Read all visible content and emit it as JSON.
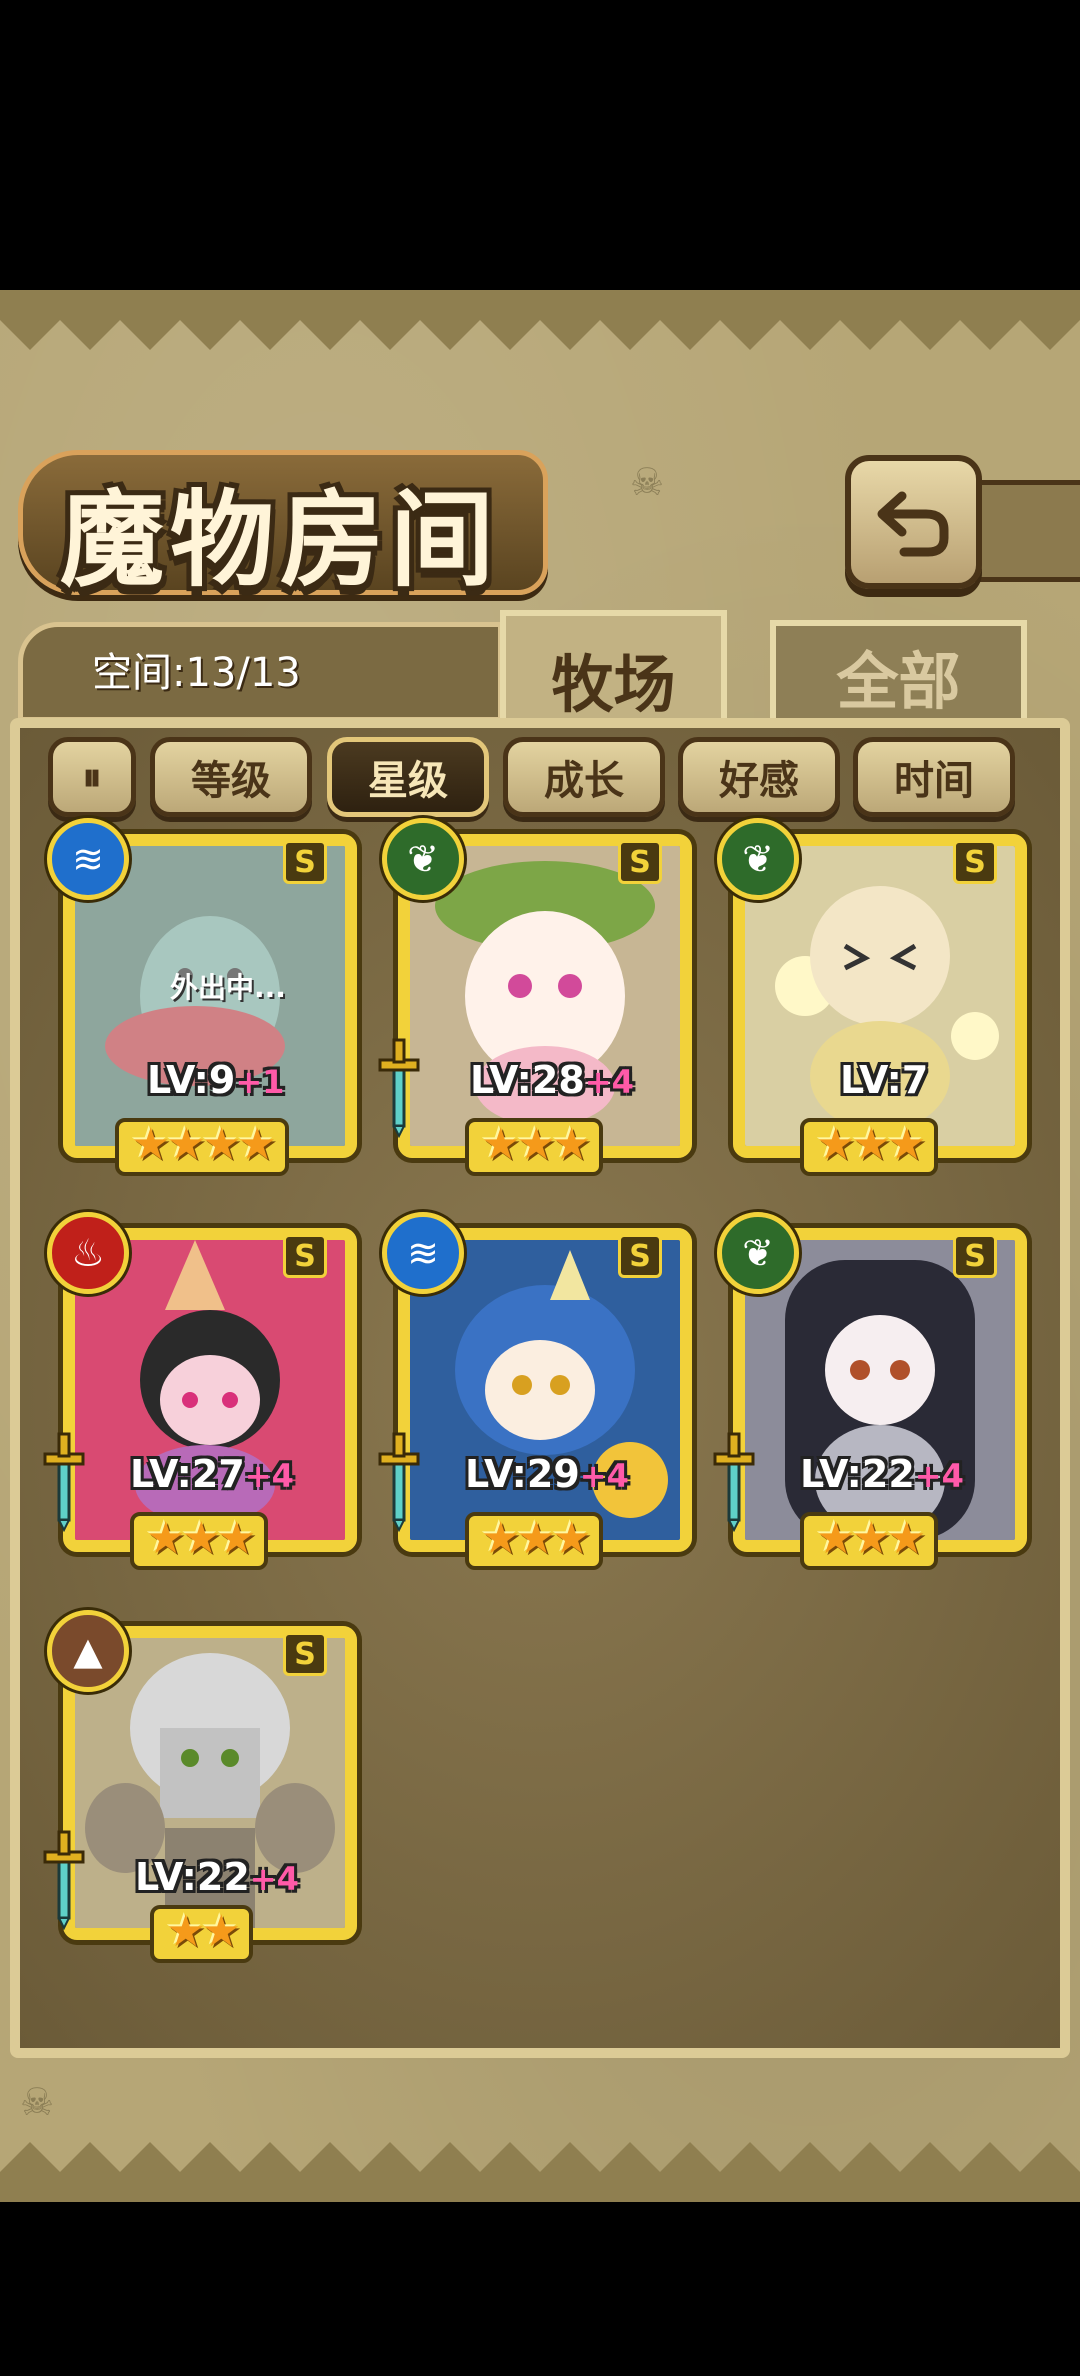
{
  "header": {
    "title": "魔物房间",
    "back_button": "return-icon"
  },
  "space": {
    "label": "空间:13/13"
  },
  "tabs": [
    {
      "label": "牧场",
      "active": true
    },
    {
      "label": "全部",
      "active": false
    }
  ],
  "filters": {
    "sort_icon": "sort-toggle-icon",
    "items": [
      {
        "label": "等级",
        "active": false
      },
      {
        "label": "星级",
        "active": true
      },
      {
        "label": "成长",
        "active": false
      },
      {
        "label": "好感",
        "active": false
      },
      {
        "label": "时间",
        "active": false
      }
    ]
  },
  "monsters": [
    {
      "grade": "S",
      "element": "water",
      "level": "LV:9",
      "bonus": "+1",
      "stars": "★★★★",
      "status": "外出中...",
      "weapon": false
    },
    {
      "grade": "S",
      "element": "wood",
      "level": "LV:28",
      "bonus": "+4",
      "stars": "★★★",
      "weapon": true
    },
    {
      "grade": "S",
      "element": "wood",
      "level": "LV:7",
      "bonus": "",
      "stars": "★★★",
      "weapon": false
    },
    {
      "grade": "S",
      "element": "fire",
      "level": "LV:27",
      "bonus": "+4",
      "stars": "★★★",
      "weapon": true
    },
    {
      "grade": "S",
      "element": "water",
      "level": "LV:29",
      "bonus": "+4",
      "stars": "★★★",
      "weapon": true
    },
    {
      "grade": "S",
      "element": "wood",
      "level": "LV:22",
      "bonus": "+4",
      "stars": "★★★",
      "weapon": true
    },
    {
      "grade": "S",
      "element": "earth",
      "level": "LV:22",
      "bonus": "+4",
      "stars": "★★",
      "weapon": true
    }
  ],
  "colors": {
    "card_frame": "#f2d23a",
    "water": "#1f6fcc",
    "wood": "#2e6b2a",
    "fire": "#c0201a",
    "earth": "#7a4a2c",
    "bonus": "#ff5aa8"
  }
}
